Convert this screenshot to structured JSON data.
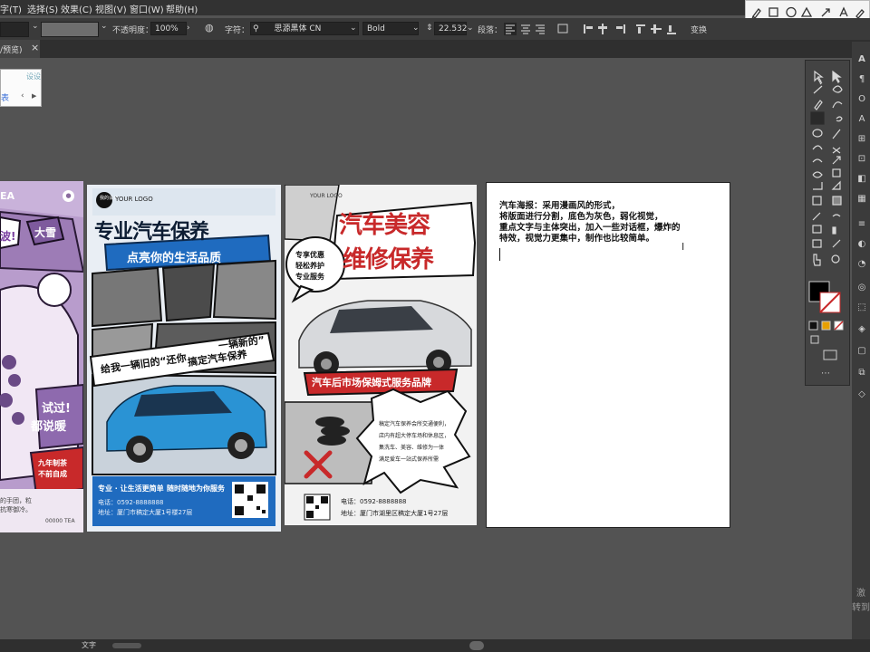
{
  "menubar": {
    "items": [
      "字(T)",
      "选择(S)",
      "效果(C)",
      "视图(V)",
      "窗口(W)",
      "帮助(H)"
    ]
  },
  "control_bar": {
    "opacity_label": "不透明度：",
    "opacity_value": "100%",
    "char_label": "字符：",
    "font_search_icon": "search-icon",
    "font_family": "思源黑体 CN",
    "font_style": "Bold",
    "font_size": "22.532",
    "paragraph_label": "段落：",
    "transform_label": "变换"
  },
  "doc_tab": {
    "label": "/预览)",
    "close_glyph": "×"
  },
  "mini_panel": {
    "badge": "设设",
    "text": "表"
  },
  "poster1": {
    "brand": "EA",
    "bubble1": "大雪",
    "bubble2": "波!",
    "tagline1": "试过!",
    "tagline2": "都说暖",
    "badge1": "九年制茶",
    "badge2": "不前自成",
    "note1": "的手团，粒",
    "note2": "抗寒御冷。",
    "code": "00000 TEA"
  },
  "poster2": {
    "logo": "YOUR LOGO",
    "logo_mark": "我的设计",
    "title": "专业汽车保养",
    "subtitle": "点亮你的生活品质",
    "slogan1": "给我一辆旧的“还你",
    "slogan2": "一辆新的”",
    "slogan3": "搞定汽车保养",
    "footer_title": "专业 · 让生活更简单",
    "footer_service": "随时随地为你服务",
    "phone": "电话：0592-8888888",
    "address": "地址：厦门市稿定大厦1号楼27层"
  },
  "poster3": {
    "logo": "YOUR LOGO",
    "title1": "汽车美容",
    "title2": "维修保养",
    "bullets": [
      "专享优惠",
      "轻松养护",
      "专业服务"
    ],
    "banner": "汽车后市场保姆式服务品牌",
    "desc": [
      "稿定汽车保养会所交通便利，",
      "店内有超大停车场和休息区，",
      "集洗车、美容、维修为一体",
      "满足爱车一站式保养所需"
    ],
    "phone": "电话：0592-8888888",
    "address": "地址：厦门市湖里区稿定大厦1号27层"
  },
  "text_board": {
    "lines": [
      "汽车海报：采用漫画风的形式，",
      "将版面进行分割，底色为灰色，弱化视觉，",
      "重点文字与主体突出，加入一些对话框，爆炸的",
      "特效，视觉力更集中，制作也比较简单。"
    ]
  },
  "right_panel": {
    "watermark_top": "激",
    "watermark_bottom": "转到"
  },
  "status_bar": {
    "tool_name": "文字"
  },
  "colors": {
    "canvas": "#535353",
    "fill_swatch": "#000000",
    "accent_red": "#c8292a",
    "accent_blue": "#1f6bbf",
    "purple": "#8a6a9e"
  }
}
